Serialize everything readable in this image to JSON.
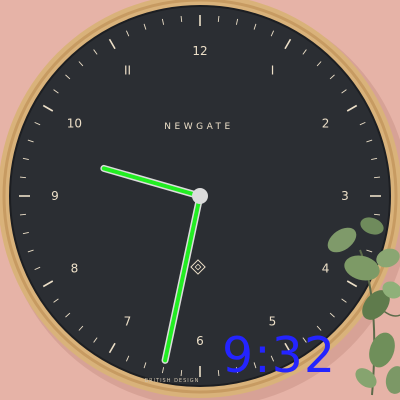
{
  "clock": {
    "brand": "NEWGATE",
    "bottom_text": "BRITISH DESIGN",
    "numerals": [
      "12",
      "1",
      "2",
      "3",
      "4",
      "5",
      "6",
      "7",
      "8",
      "9",
      "10",
      "11"
    ],
    "numeral_display": [
      "12",
      "I",
      "2",
      "3",
      "4",
      "5",
      "6",
      "7",
      "8",
      "9",
      "10",
      "II"
    ],
    "time": {
      "hour": 9,
      "minute": 32
    },
    "colors": {
      "wall": "#e4b0a4",
      "rim": "#d8b27c",
      "dial": "#2b2e33",
      "markings": "#ecdfc8",
      "hands": "#22ee22",
      "hand_outline": "#dcdcdc"
    }
  },
  "overlay": {
    "time_text": "9:32",
    "color": "#2424ff"
  }
}
